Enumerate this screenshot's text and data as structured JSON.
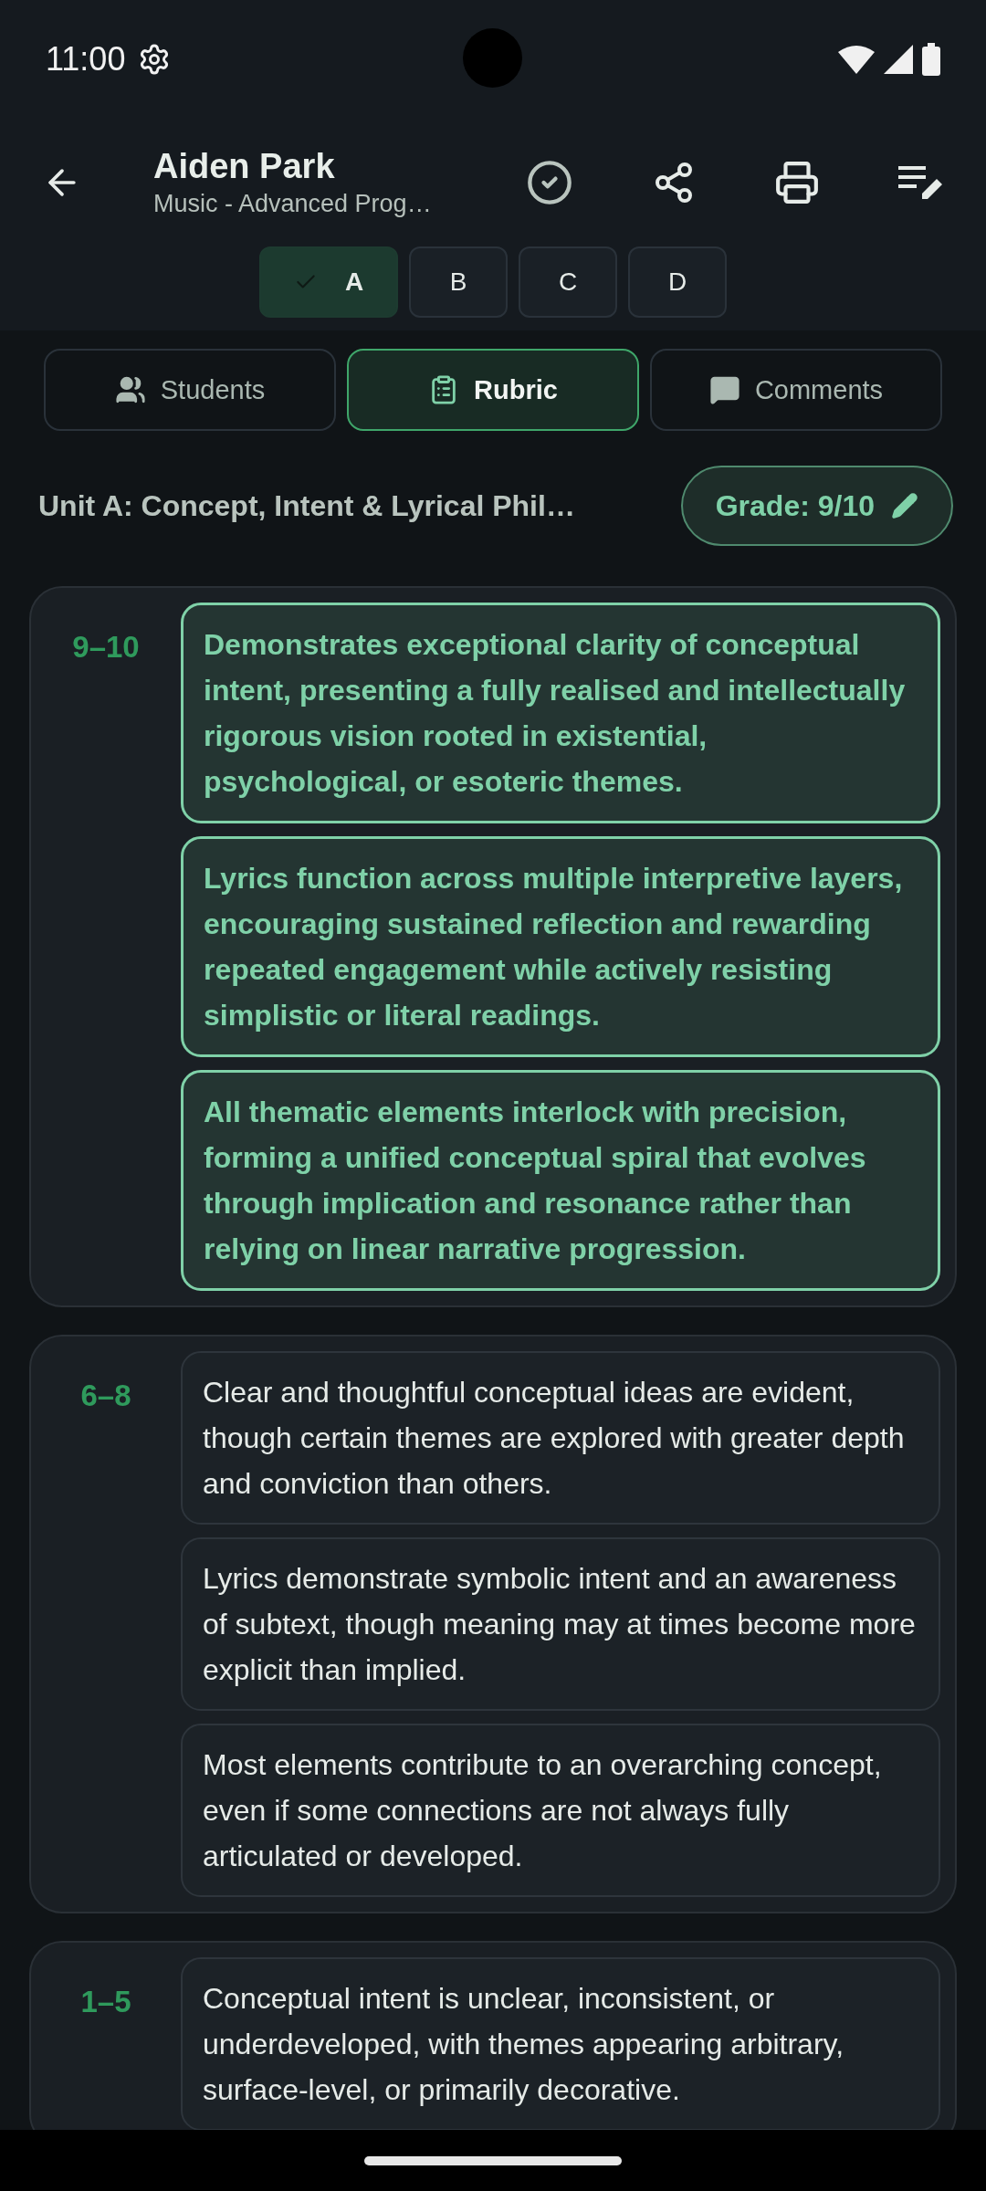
{
  "status_bar": {
    "time": "11:00"
  },
  "app_bar": {
    "title": "Aiden Park",
    "subtitle": "Music - Advanced Prog…"
  },
  "segments": [
    {
      "label": "A",
      "selected": true
    },
    {
      "label": "B",
      "selected": false
    },
    {
      "label": "C",
      "selected": false
    },
    {
      "label": "D",
      "selected": false
    }
  ],
  "tabs": [
    {
      "label": "Students",
      "kind": "students",
      "selected": false
    },
    {
      "label": "Rubric",
      "kind": "rubric",
      "selected": true
    },
    {
      "label": "Comments",
      "kind": "comments",
      "selected": false
    }
  ],
  "unit": {
    "title": "Unit A: Concept, Intent & Lyrical Phil…",
    "grade": "Grade: 9/10"
  },
  "bands": [
    {
      "score": "9–10",
      "descriptors": [
        {
          "text": "Demonstrates exceptional clarity of conceptual intent, presenting a fully realised and intellectually rigorous vision rooted in existential, psychological, or esoteric themes.",
          "selected": true
        },
        {
          "text": "Lyrics function across multiple interpretive layers, encouraging sustained reflection and rewarding repeated engagement while actively resisting simplistic or literal readings.",
          "selected": true
        },
        {
          "text": "All thematic elements interlock with precision, forming a unified conceptual spiral that evolves through implication and resonance rather than relying on linear narrative progression.",
          "selected": true
        }
      ]
    },
    {
      "score": "6–8",
      "descriptors": [
        {
          "text": "Clear and thoughtful conceptual ideas are evident, though certain themes are explored with greater depth and conviction than others.",
          "selected": false
        },
        {
          "text": "Lyrics demonstrate symbolic intent and an awareness of subtext, though meaning may at times become more explicit than implied.",
          "selected": false
        },
        {
          "text": "Most elements contribute to an overarching concept, even if some connections are not always fully articulated or developed.",
          "selected": false
        }
      ]
    },
    {
      "score": "1–5",
      "descriptors": [
        {
          "text": "Conceptual intent is unclear, inconsistent, or underdeveloped, with themes appearing arbitrary, surface-level, or primarily decorative.",
          "selected": false
        }
      ]
    }
  ]
}
